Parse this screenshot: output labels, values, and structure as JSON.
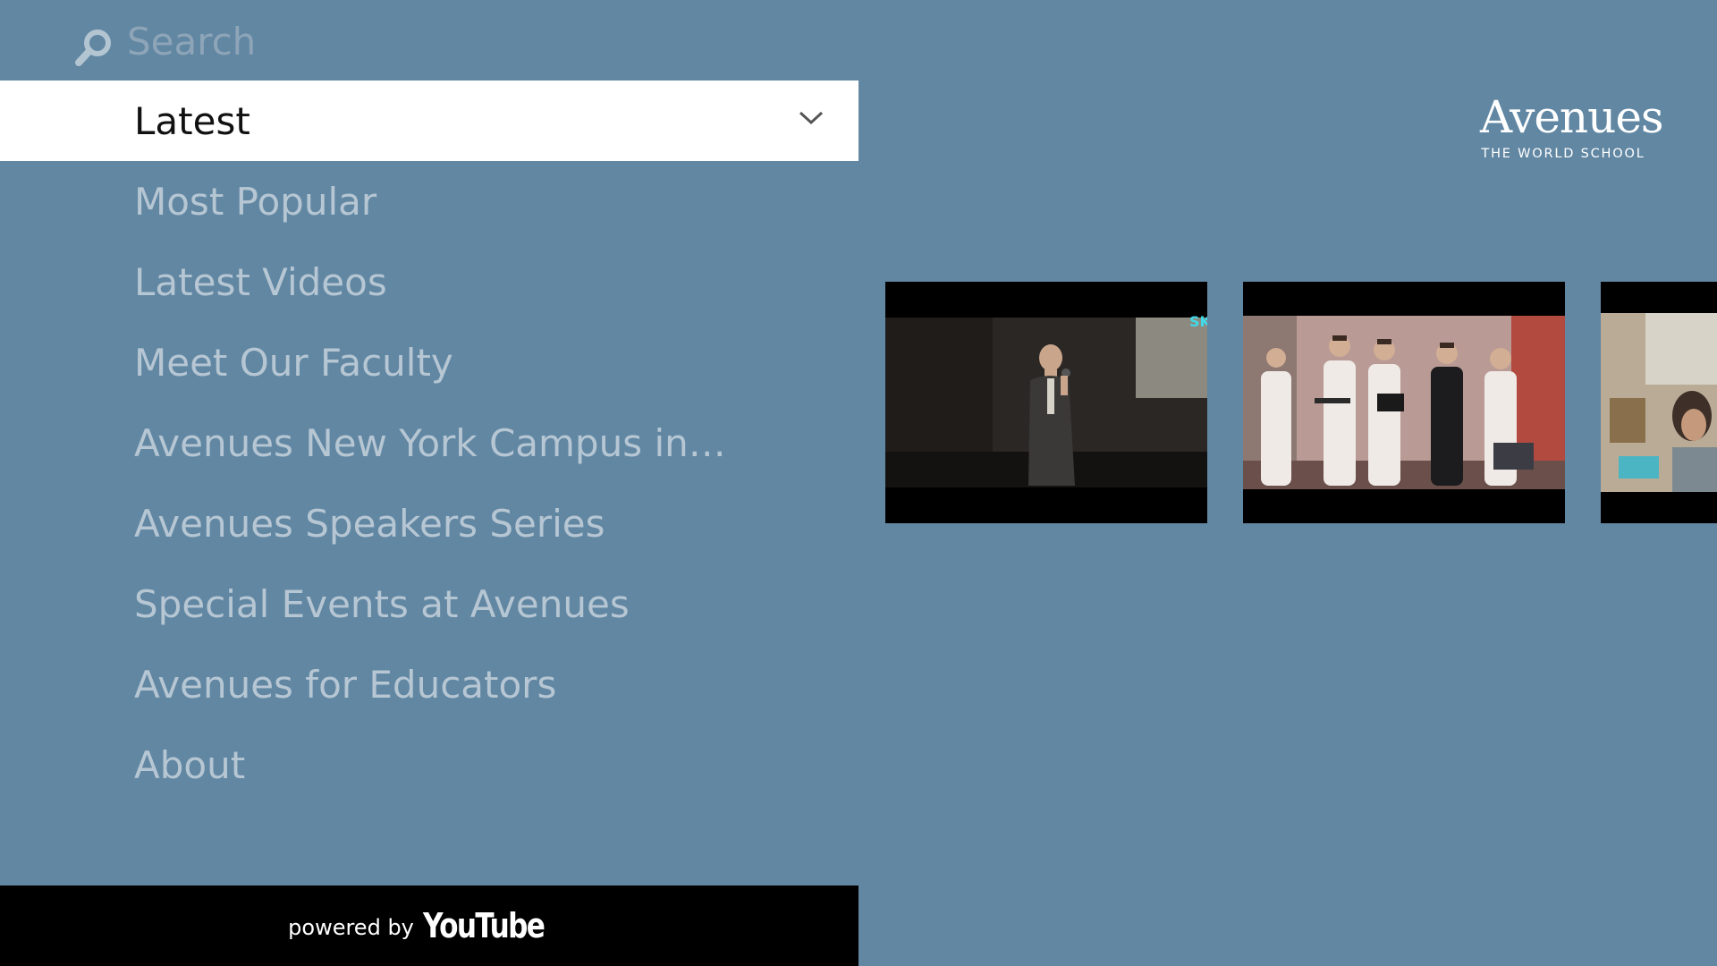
{
  "search": {
    "placeholder": "Search"
  },
  "menu": {
    "items": [
      {
        "label": "Latest",
        "selected": true
      },
      {
        "label": "Most Popular"
      },
      {
        "label": "Latest Videos"
      },
      {
        "label": "Meet Our Faculty"
      },
      {
        "label": "Avenues New York Campus in…"
      },
      {
        "label": "Avenues Speakers Series"
      },
      {
        "label": "Special Events at Avenues"
      },
      {
        "label": "Avenues for Educators"
      },
      {
        "label": "About"
      }
    ]
  },
  "footer": {
    "powered_by": "powered by",
    "brand": "YouTube"
  },
  "logo": {
    "name": "Avenues",
    "tagline": "THE WORLD SCHOOL"
  },
  "thumbnails": [
    {
      "overlay_text": "SK"
    },
    {},
    {}
  ],
  "colors": {
    "background": "#6187a3",
    "menu_text": "#b6c6d3",
    "selected_bg": "#ffffff",
    "selected_text": "#111111",
    "footer_bg": "#000000"
  }
}
